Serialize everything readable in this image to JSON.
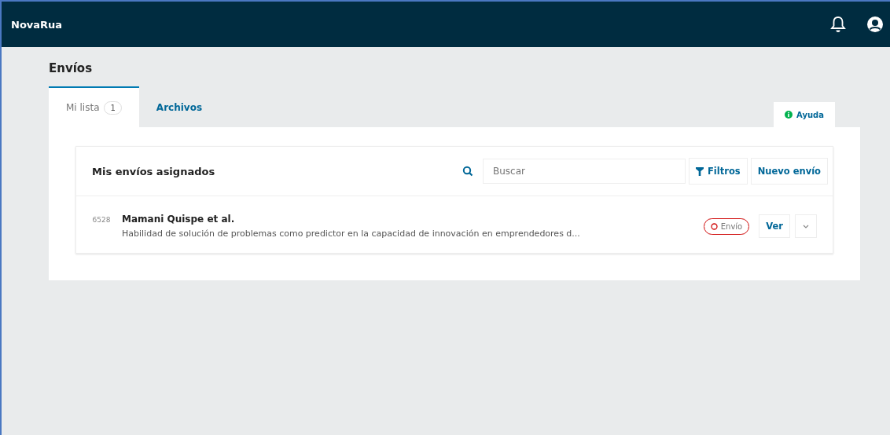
{
  "header": {
    "brand": "NovaRua"
  },
  "page_title": "Envíos",
  "tabs": [
    {
      "label": "Mi lista",
      "count": "1",
      "selected": true
    },
    {
      "label": "Archivos",
      "selected": false
    }
  ],
  "help": {
    "label": "Ayuda"
  },
  "list": {
    "title": "Mis envíos asignados",
    "search": {
      "placeholder": "Buscar"
    },
    "filter_button": "Filtros",
    "new_button": "Nuevo envío",
    "items": [
      {
        "id": "6528",
        "authors": "Mamani Quispe et al.",
        "title": "Habilidad de solución de problemas como predictor en la capacidad de innovación en emprendedores d...",
        "stage": "Envío",
        "view": "Ver"
      }
    ]
  }
}
